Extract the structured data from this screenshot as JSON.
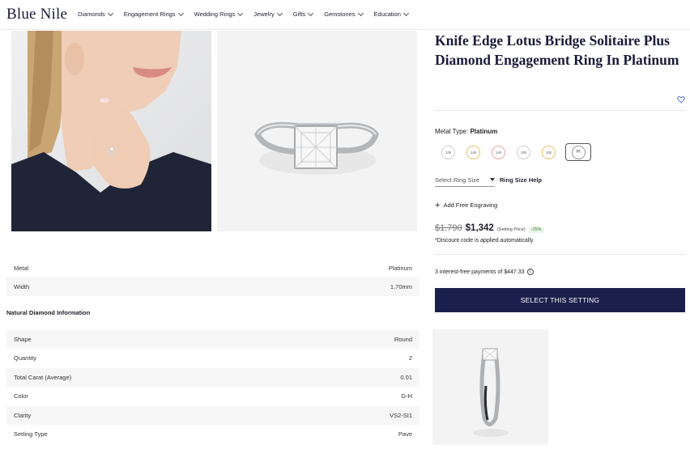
{
  "header": {
    "logo": "Blue Nile",
    "nav": [
      "Diamonds",
      "Engagement Rings",
      "Wedding Rings",
      "Jewelry",
      "Gifts",
      "Gemstones",
      "Education"
    ]
  },
  "product": {
    "title": "Knife Edge Lotus Bridge Solitaire Plus Diamond Engagement Ring In Platinum",
    "metal_label": "Metal Type:",
    "metal_value": "Platinum",
    "swatches": [
      {
        "label": "14k",
        "color": "#cfcfcf"
      },
      {
        "label": "14k",
        "color": "#e8c070"
      },
      {
        "label": "14k",
        "color": "#eaa6a6"
      },
      {
        "label": "18k",
        "color": "#cfcfcf"
      },
      {
        "label": "18k",
        "color": "#e8c070"
      },
      {
        "label": "Pt",
        "color": "#999999"
      }
    ],
    "ring_size_placeholder": "Select Ring Size",
    "ring_size_help": "Ring Size Help",
    "engraving": "Add Free Engraving",
    "old_price": "$1,790",
    "new_price": "$1,342",
    "price_note": "(Setting Price)",
    "discount": "-25%",
    "discount_note": "*Discount code is applied automatically",
    "interest": "3 interest-free payments of $447.33",
    "cta": "SELECT THIS SETTING"
  },
  "specs": {
    "metal": {
      "label": "Metal",
      "value": "Platinum"
    },
    "width": {
      "label": "Width",
      "value": "1.70mm"
    },
    "section_title": "Natural Diamond Information",
    "rows": [
      {
        "label": "Shape",
        "value": "Round"
      },
      {
        "label": "Quantity",
        "value": "2"
      },
      {
        "label": "Total Carat (Average)",
        "value": "0.01"
      },
      {
        "label": "Color",
        "value": "G-H"
      },
      {
        "label": "Clarity",
        "value": "VS2-SI1"
      },
      {
        "label": "Setting Type",
        "value": "Pave"
      }
    ]
  },
  "colors": {
    "brand": "#1b1f4b",
    "discount_green": "#2e7d32",
    "heart": "#3b5bdb"
  }
}
